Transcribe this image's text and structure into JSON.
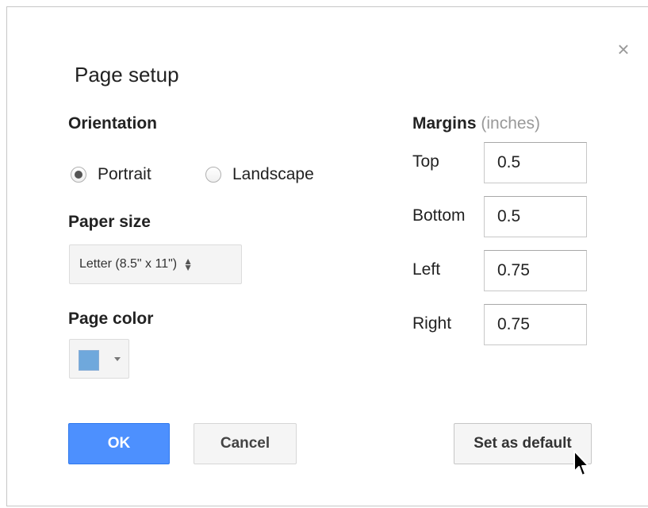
{
  "dialog": {
    "title": "Page setup",
    "close_glyph": "×"
  },
  "orientation": {
    "label": "Orientation",
    "options": [
      {
        "label": "Portrait",
        "selected": true
      },
      {
        "label": "Landscape",
        "selected": false
      }
    ]
  },
  "paper_size": {
    "label": "Paper size",
    "selected": "Letter (8.5\" x 11\")"
  },
  "page_color": {
    "label": "Page color",
    "value": "#6fa8dc"
  },
  "margins": {
    "label": "Margins",
    "unit": "(inches)",
    "fields": [
      {
        "label": "Top",
        "value": "0.5"
      },
      {
        "label": "Bottom",
        "value": "0.5"
      },
      {
        "label": "Left",
        "value": "0.75"
      },
      {
        "label": "Right",
        "value": "0.75"
      }
    ]
  },
  "buttons": {
    "ok": "OK",
    "cancel": "Cancel",
    "set_default": "Set as default"
  },
  "colors": {
    "primary": "#4d90fe"
  }
}
